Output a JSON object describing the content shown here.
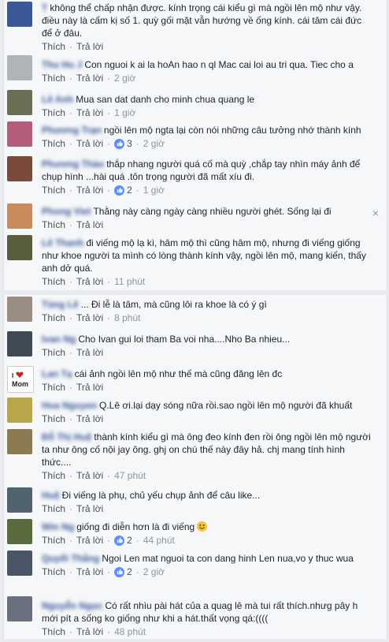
{
  "like_label": "Thích",
  "reply_label": "Trả lời",
  "close_glyph": "×",
  "colors": {
    "link": "#365899",
    "like_blue": "#5890ff",
    "meta": "#90949c"
  },
  "panel_a": [
    {
      "name": "T",
      "text": "không thể chấp nhận được. kính trọng cái kiểu gì mà ngồi lên mộ như vậy. điều này là cấm kị số 1. quỳ gối mặt vẫn hướng về ống kính. cái tâm cái đức để ở đâu.",
      "likes": "",
      "time": ""
    },
    {
      "name": "Thu Hu J",
      "text": "Con nguoi k ai la hoAn hao n ql Mac cai loi au tri qua. Tiec cho a",
      "likes": "",
      "time": "2 giờ"
    },
    {
      "name": "Lê Anh",
      "text": "Mua san dat danh cho minh chua quang le",
      "likes": "",
      "time": "1 giờ"
    },
    {
      "name": "Phương Trạn",
      "text": "ngồi lên mộ ngta lại còn nói những câu tưởng nhớ thành kính",
      "likes": "3",
      "time": "2 giờ"
    },
    {
      "name": "Phương Thảo",
      "text": "thắp nhang người quá cố mà quỳ ,chắp tay nhìn máy ảnh để chụp hình ...hài quá .tôn trọng người đã mất xíu đi.",
      "likes": "2",
      "time": "1 giờ"
    },
    {
      "name": "Phong Viet",
      "text": "Thằng này càng ngày càng nhiều người ghét. Sống lại đi",
      "likes": "",
      "time": ""
    },
    {
      "name": "Lê Thanh",
      "text": "đi viếng mộ lạ kì, hâm mộ thì cũng hâm mộ, nhưng đi viếng giống như khoe người ta mình có lòng thành kính vậy, ngồi lên mộ, mang kiến, thấy anh dở quá.",
      "likes": "",
      "time": "11 phút"
    }
  ],
  "panel_b": [
    {
      "name": "Tùng Lê",
      "text": "... Đi lễ là tâm, mà cũng lôi ra khoe là có ý gì",
      "likes": "",
      "time": "8 phút"
    },
    {
      "name": "Ivan Ng",
      "text": "Cho Ivan gui loi tham Ba voi nha....Nho Ba nhieu...",
      "likes": "",
      "time": ""
    },
    {
      "name": "Lan Tạ",
      "text": "cái ảnh ngồi lên mộ như thế mà cũng đăng lên đc",
      "likes": "",
      "time": ""
    },
    {
      "name": "Hoa Nguyen",
      "text": "Q.Lê ơi.lại dạy sóng nữa rồi.sao ngồi lên mộ người đã khuất",
      "likes": "",
      "time": ""
    },
    {
      "name": "Đỗ Thị Huệ",
      "text": "thành kính kiểu gì mà ông đeo kính đen rồi ông ngồi lên mộ người ta như ông cố nội jay ông. ghj on chú thế này đây hả. chj mang tính hình thức....",
      "likes": "",
      "time": "47 phút"
    },
    {
      "name": "Huệ",
      "text": "Đi viếng là phụ, chủ yếu chụp ảnh để câu like...",
      "likes": "",
      "time": ""
    },
    {
      "name": "Win Ng",
      "text": "giống đi diễn hơn là đi viếng",
      "likes": "2",
      "time": "44 phút",
      "emoji": true
    },
    {
      "name": "Quyết Thắng",
      "text": "Ngoi Len mat nguoi ta con dang hinh Len nua,vo y thuc wua",
      "likes": "2",
      "time": "2 giờ"
    },
    {
      "name": "Nguyễn Ngọc",
      "text": "Có rất nhìu pài hát của a quag lê mà tui rất thích.nhưg pây h mới pít a sống ko giống như khi a hát.thất vọng qá:((((",
      "likes": "",
      "time": "48 phút"
    }
  ]
}
